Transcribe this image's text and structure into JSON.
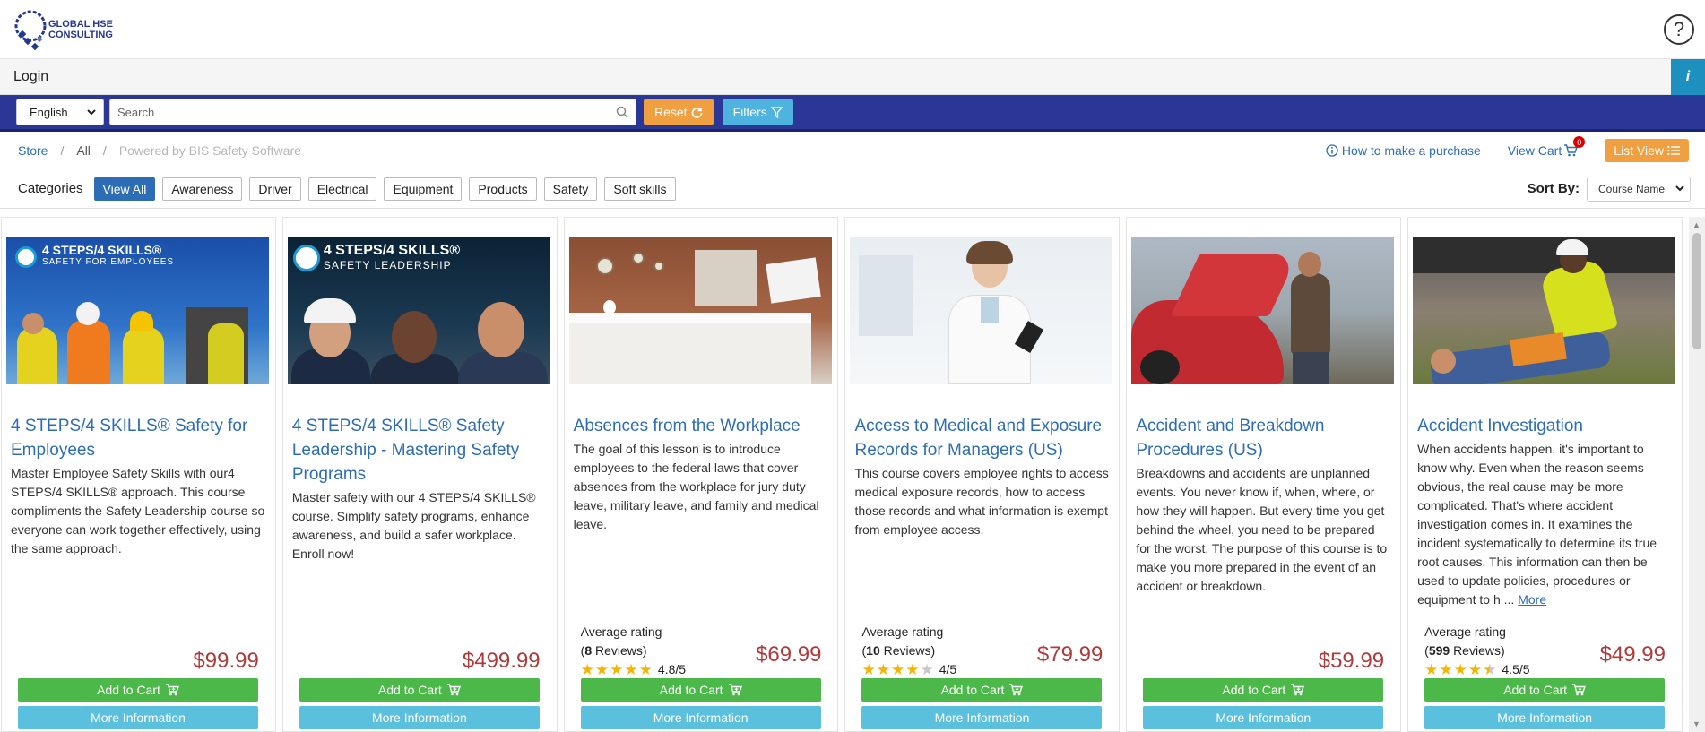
{
  "header": {
    "logo_line1": "GLOBAL HSE",
    "logo_line2": "CONSULTING",
    "help": "?"
  },
  "login_bar": {
    "login": "Login",
    "info": "i"
  },
  "search_bar": {
    "language": "English",
    "search_placeholder": "Search",
    "reset": "Reset",
    "filters": "Filters"
  },
  "breadcrumb": {
    "store": "Store",
    "all": "All",
    "powered": "Powered by BIS Safety Software",
    "sep": "/"
  },
  "nav": {
    "how_to": "How to make a purchase",
    "view_cart": "View Cart",
    "cart_count": "0",
    "list_view": "List View"
  },
  "categories": {
    "label": "Categories",
    "items": [
      "View All",
      "Awareness",
      "Driver",
      "Electrical",
      "Equipment",
      "Products",
      "Safety",
      "Soft skills"
    ]
  },
  "sort": {
    "label": "Sort By:",
    "value": "Course Name"
  },
  "cards": [
    {
      "banner1": "4 STEPS/4 SKILLS®",
      "banner2": "SAFETY FOR EMPLOYEES",
      "title": "4 STEPS/4 SKILLS® Safety for Employees",
      "desc": "Master Employee Safety Skills with our4 STEPS/4 SKILLS® approach. This course compliments the Safety Leadership course so everyone can work together effectively, using the same approach.",
      "price": "$99.99",
      "add_to_cart": "Add to Cart",
      "more_info": "More Information"
    },
    {
      "banner1": "4 STEPS/4 SKILLS®",
      "banner2": "SAFETY LEADERSHIP",
      "title": "4 STEPS/4 SKILLS® Safety Leadership - Mastering Safety Programs",
      "desc": "Master safety with our 4 STEPS/4 SKILLS® course. Simplify safety programs, enhance awareness, and build a safer workplace. Enroll now!",
      "price": "$499.99",
      "add_to_cart": "Add to Cart",
      "more_info": "More Information"
    },
    {
      "title": "Absences from the Workplace",
      "desc": "The goal of this lesson is to introduce employees to the federal laws that cover absences from the workplace for jury duty leave, military leave, and family and medical leave.",
      "rating_label": "Average rating",
      "reviews_count": "8",
      "reviews_word": "Reviews",
      "rating_value": 4.8,
      "score": "4.8/5",
      "price": "$69.99",
      "add_to_cart": "Add to Cart",
      "more_info": "More Information"
    },
    {
      "title": "Access to Medical and Exposure Records for Managers (US)",
      "desc": "This course covers employee rights to access medical exposure records, how to access those records and what information is exempt from employee access.",
      "rating_label": "Average rating",
      "reviews_count": "10",
      "reviews_word": "Reviews",
      "rating_value": 4,
      "score": "4/5",
      "price": "$79.99",
      "add_to_cart": "Add to Cart",
      "more_info": "More Information"
    },
    {
      "title": "Accident and Breakdown Procedures (US)",
      "desc": "Breakdowns and accidents are unplanned events. You never know if, when, where, or how they will happen. But every time you get behind the wheel, you need to be prepared for the worst. The purpose of this course is to make you more prepared in the event of an accident or breakdown.",
      "price": "$59.99",
      "add_to_cart": "Add to Cart",
      "more_info": "More Information"
    },
    {
      "title": "Accident Investigation",
      "desc": "When accidents happen, it's important to know why. Even when the reason seems obvious, the real cause may be more complicated. That's where accident investigation comes in. It examines the incident systematically to determine its true root causes. This information can then be used to update policies, procedures or equipment to h ...",
      "more": "More",
      "rating_label": "Average rating",
      "reviews_count": "599",
      "reviews_word": "Reviews",
      "rating_value": 4.5,
      "score": "4.5/5",
      "price": "$49.99",
      "add_to_cart": "Add to Cart",
      "more_info": "More Information"
    }
  ],
  "colors": {
    "brand_blue": "#2b3797",
    "link": "#2d6db5",
    "reset_orange": "#f0a040",
    "filters_blue": "#4fb3df",
    "cart_green": "#4cb84a",
    "info_cyan": "#5bc0de",
    "price_red": "#b03a3a",
    "star": "#f5b400"
  }
}
